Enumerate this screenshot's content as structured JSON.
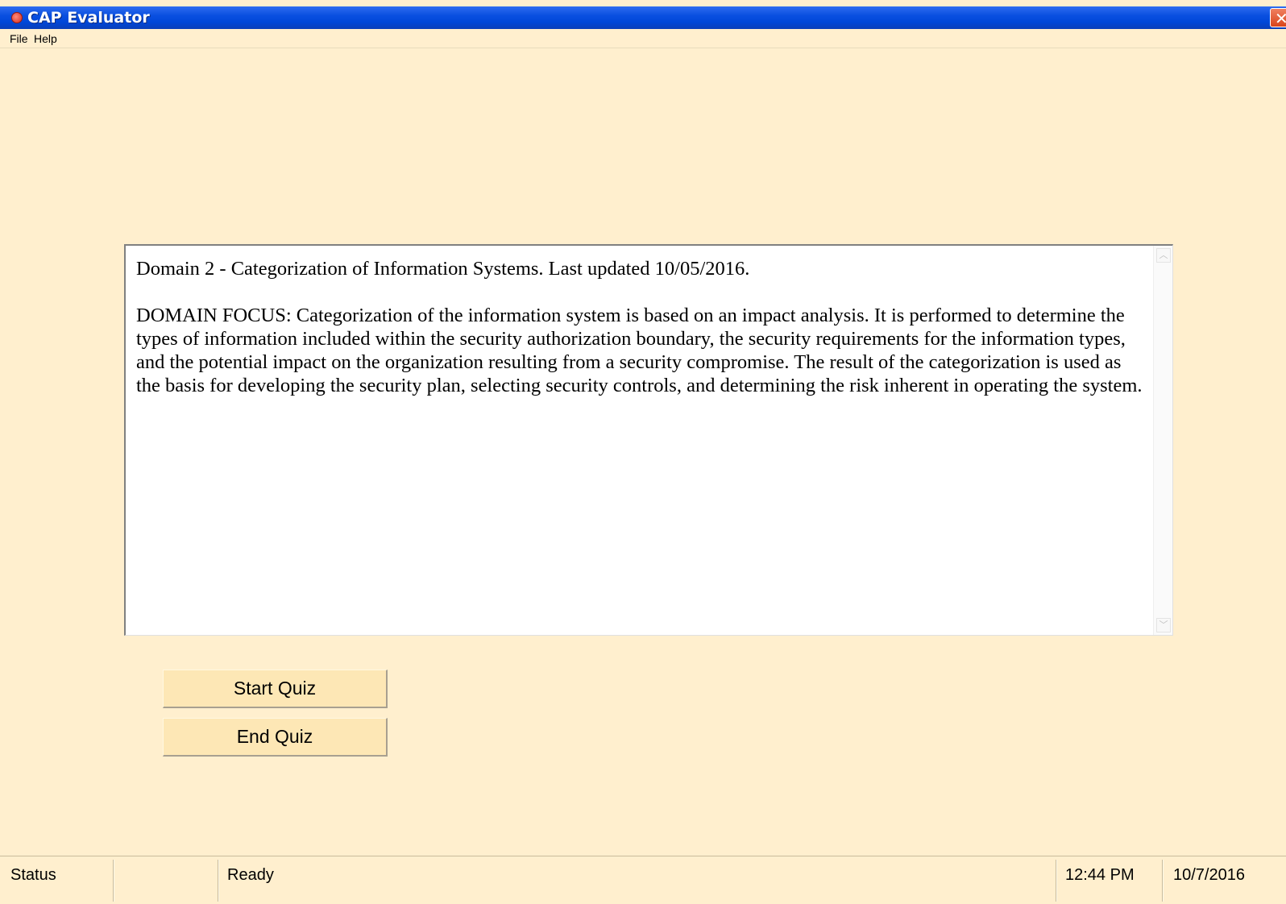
{
  "window": {
    "title": "CAP Evaluator",
    "close_glyph": "✕"
  },
  "menu": {
    "items": [
      "File",
      "Help"
    ]
  },
  "content": {
    "heading": "Domain 2 - Categorization of Information Systems. Last updated 10/05/2016.",
    "body": "DOMAIN FOCUS: Categorization of the information system is based on an impact analysis. It is performed to determine the types of information included within the security authorization boundary, the security requirements for the information types, and the potential impact on the organization resulting from a security compromise. The result of the categorization is used as the basis for developing the security plan, selecting security controls, and determining the risk inherent in operating the system."
  },
  "scrollbar": {
    "up_glyph": "︿",
    "down_glyph": "﹀"
  },
  "buttons": {
    "start_quiz": "Start Quiz",
    "end_quiz": "End Quiz"
  },
  "statusbar": {
    "label": "Status",
    "text": "Ready",
    "time": "12:44 PM",
    "date": "10/7/2016"
  },
  "colors": {
    "background": "#ffefce",
    "titlebar": "#0047d8",
    "button": "#fde7b5"
  },
  "icons": {
    "app": "app-icon",
    "close": "close-icon"
  }
}
